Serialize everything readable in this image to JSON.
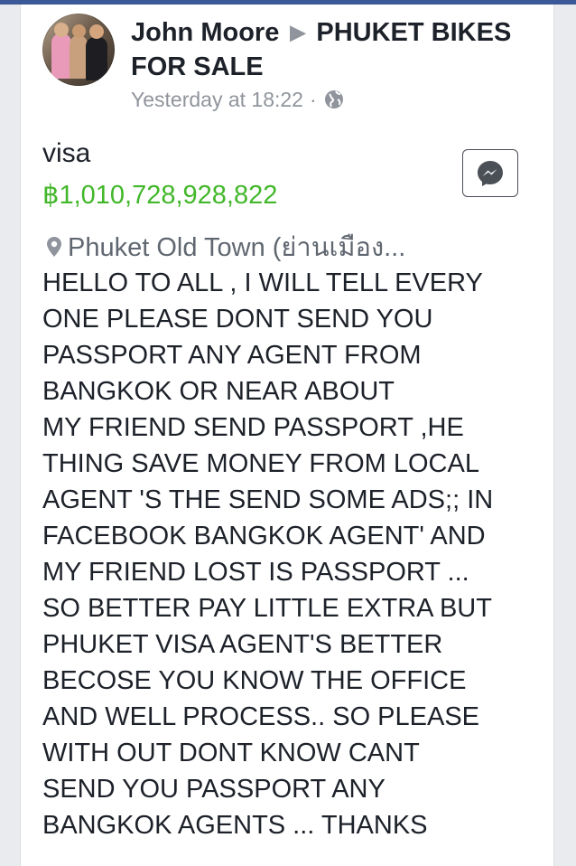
{
  "post": {
    "author": "John Moore",
    "group": "PHUKET BIKES FOR SALE",
    "timestamp": "Yesterday at 18:22",
    "separator": "·",
    "privacy_icon": "globe-icon"
  },
  "listing": {
    "title": "visa",
    "price": "฿1,010,728,928,822",
    "location": "Phuket Old Town (ย่านเมือง...",
    "message_icon": "messenger-icon",
    "description": "HELLO TO ALL , I WILL TELL EVERY\nONE PLEASE DONT SEND YOU\nPASSPORT ANY AGENT FROM\nBANGKOK OR NEAR ABOUT\nMY FRIEND SEND PASSPORT ,HE\nTHING SAVE MONEY   FROM LOCAL\nAGENT 'S THE SEND SOME ADS;; IN\nFACEBOOK BANGKOK AGENT' AND\nMY FRIEND LOST IS PASSPORT ...\nSO BETTER PAY LITTLE EXTRA BUT\nPHUKET VISA AGENT'S BETTER\nBECOSE YOU KNOW THE OFFICE\nAND WELL PROCESS.. SO PLEASE\nWITH OUT DONT KNOW CANT\nSEND YOU PASSPORT ANY\nBANGKOK AGENTS ... THANKS"
  },
  "colors": {
    "brand": "#3b5998",
    "price": "#42b72a",
    "meta": "#90949c",
    "text": "#1d2129"
  }
}
